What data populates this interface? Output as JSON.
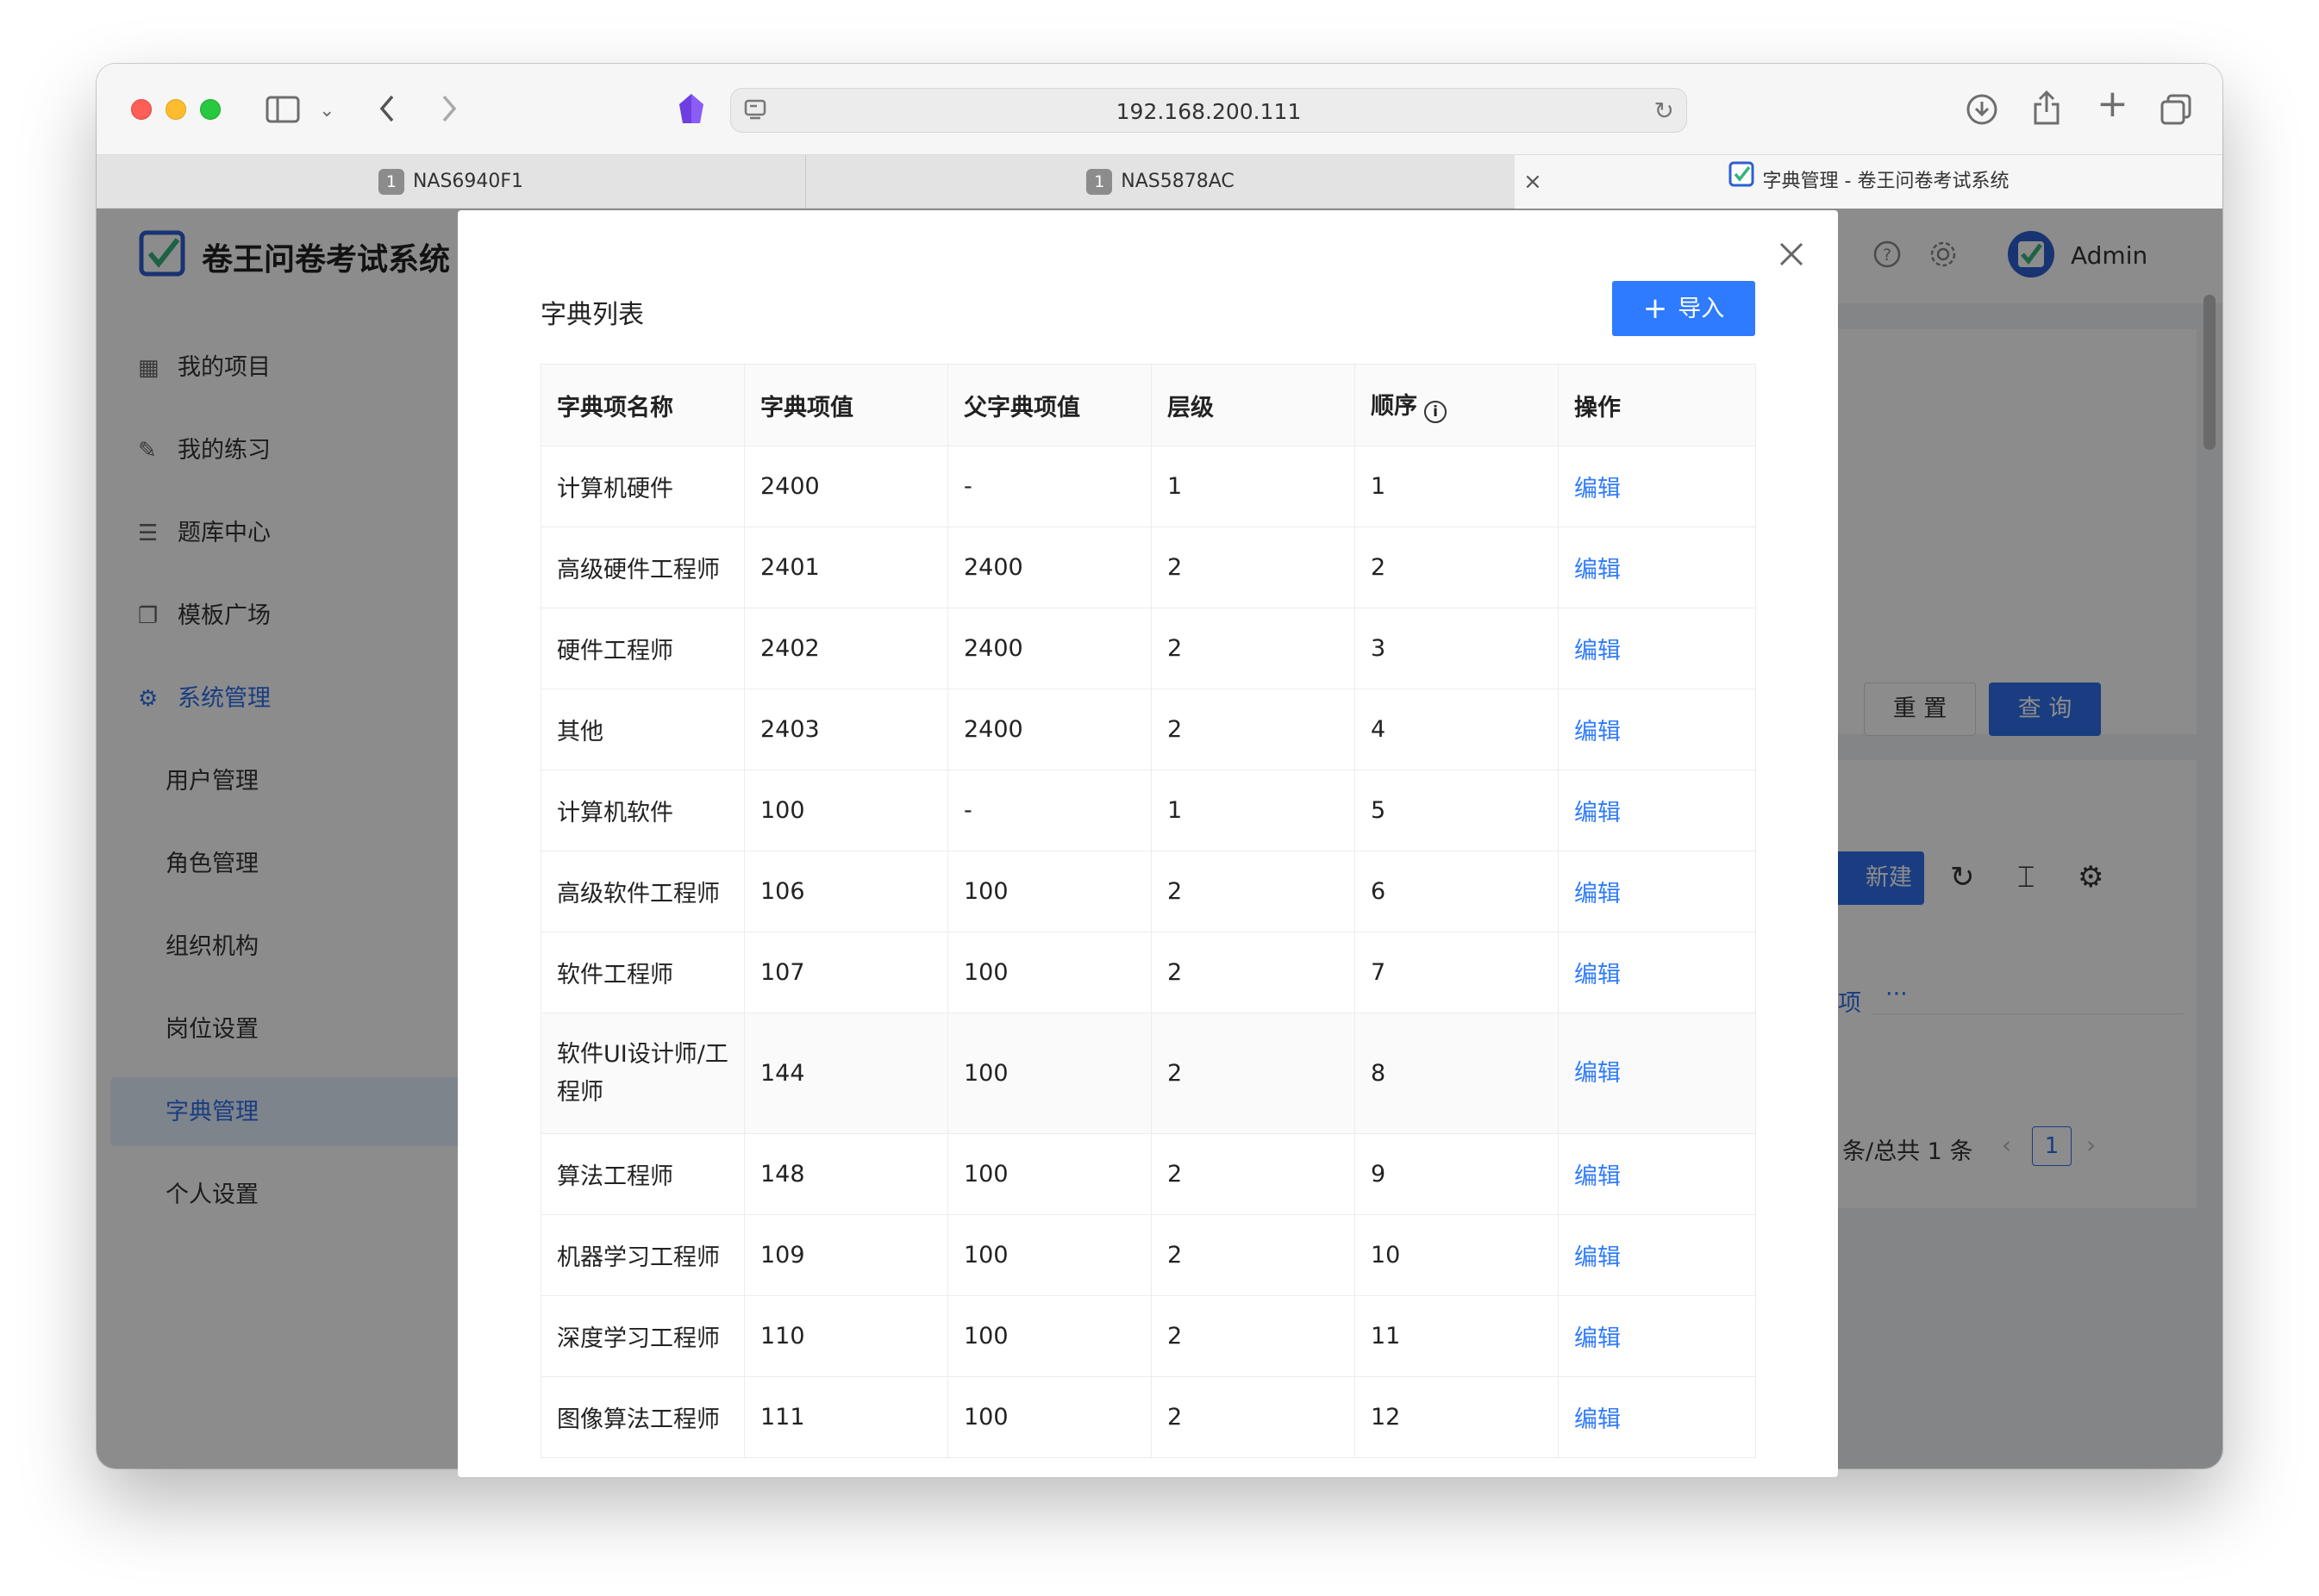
{
  "browser": {
    "url": "192.168.200.111",
    "tabs": [
      {
        "badge": "1",
        "label": "NAS6940F1"
      },
      {
        "badge": "1",
        "label": "NAS5878AC"
      },
      {
        "label": "字典管理 - 卷王问卷考试系统"
      }
    ],
    "close_tab_glyph": "×"
  },
  "app": {
    "title": "卷王问卷考试系统",
    "user": "Admin",
    "sidebar": {
      "items": [
        {
          "label": "我的项目",
          "icon": "board-icon"
        },
        {
          "label": "我的练习",
          "icon": "edit-icon"
        },
        {
          "label": "题库中心",
          "icon": "list-icon"
        },
        {
          "label": "模板广场",
          "icon": "copy-icon"
        },
        {
          "label": "系统管理",
          "icon": "gear-icon"
        }
      ],
      "sub_items": [
        "用户管理",
        "角色管理",
        "组织机构",
        "岗位设置",
        "字典管理",
        "个人设置"
      ]
    },
    "buttons": {
      "reset": "重 置",
      "query": "查 询",
      "new": "新建"
    },
    "pager": {
      "summary": "条/总共 1 条",
      "page": "1"
    },
    "row_fragment": "项",
    "more": "···"
  },
  "modal": {
    "title": "字典列表",
    "import_label": "导入",
    "columns": [
      "字典项名称",
      "字典项值",
      "父字典项值",
      "层级",
      "顺序",
      "操作"
    ],
    "rows": [
      [
        "计算机硬件",
        "2400",
        "-",
        "1",
        "1",
        "编辑"
      ],
      [
        "高级硬件工程师",
        "2401",
        "2400",
        "2",
        "2",
        "编辑"
      ],
      [
        "硬件工程师",
        "2402",
        "2400",
        "2",
        "3",
        "编辑"
      ],
      [
        "其他",
        "2403",
        "2400",
        "2",
        "4",
        "编辑"
      ],
      [
        "计算机软件",
        "100",
        "-",
        "1",
        "5",
        "编辑"
      ],
      [
        "高级软件工程师",
        "106",
        "100",
        "2",
        "6",
        "编辑"
      ],
      [
        "软件工程师",
        "107",
        "100",
        "2",
        "7",
        "编辑"
      ],
      [
        "软件UI设计师/工程师",
        "144",
        "100",
        "2",
        "8",
        "编辑"
      ],
      [
        "算法工程师",
        "148",
        "100",
        "2",
        "9",
        "编辑"
      ],
      [
        "机器学习工程师",
        "109",
        "100",
        "2",
        "10",
        "编辑"
      ],
      [
        "深度学习工程师",
        "110",
        "100",
        "2",
        "11",
        "编辑"
      ],
      [
        "图像算法工程师",
        "111",
        "100",
        "2",
        "12",
        "编辑"
      ]
    ]
  },
  "colors": {
    "primary": "#2f7bff",
    "link": "#2f7bff"
  }
}
